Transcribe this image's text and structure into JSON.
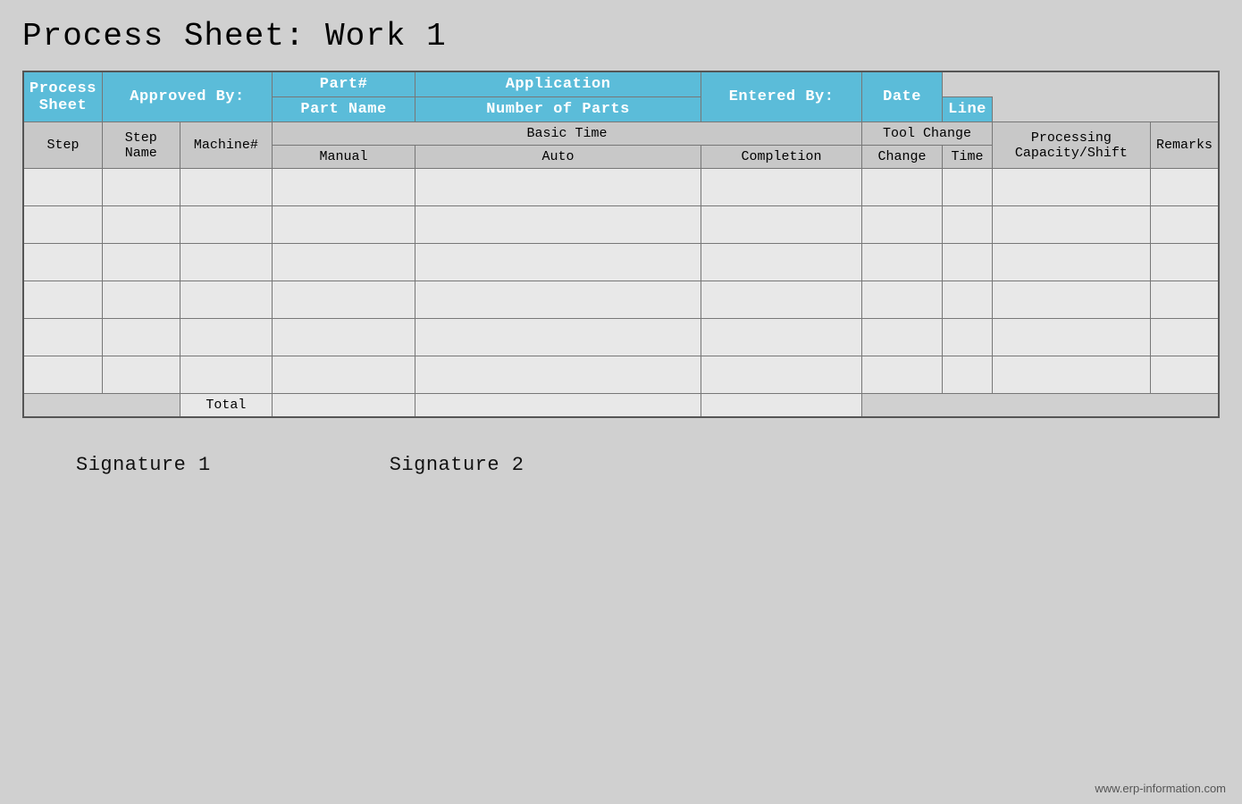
{
  "title": "Process Sheet: Work 1",
  "header_row1": {
    "process_sheet": "Process Sheet",
    "approved_by": "Approved By:",
    "part_hash": "Part#",
    "application": "Application",
    "entered_by": "Entered By:",
    "date": "Date"
  },
  "header_row2": {
    "part_name": "Part Name",
    "number_of_parts": "Number of Parts",
    "line": "Line"
  },
  "col_headers": {
    "step": "Step",
    "step_name": "Step  Name",
    "machine": "Machine#",
    "basic_time": "Basic Time",
    "manual": "Manual",
    "auto": "Auto",
    "completion": "Completion",
    "tool_change": "Tool Change",
    "change": "Change",
    "time": "Time",
    "processing_capacity": "Processing Capacity/Shift",
    "remarks": "Remarks"
  },
  "data_rows": [
    {
      "step": "",
      "step_name": "",
      "machine": "",
      "manual": "",
      "auto": "",
      "completion": "",
      "change": "",
      "time": "",
      "processing": "",
      "remarks": ""
    },
    {
      "step": "",
      "step_name": "",
      "machine": "",
      "manual": "",
      "auto": "",
      "completion": "",
      "change": "",
      "time": "",
      "processing": "",
      "remarks": ""
    },
    {
      "step": "",
      "step_name": "",
      "machine": "",
      "manual": "",
      "auto": "",
      "completion": "",
      "change": "",
      "time": "",
      "processing": "",
      "remarks": ""
    },
    {
      "step": "",
      "step_name": "",
      "machine": "",
      "manual": "",
      "auto": "",
      "completion": "",
      "change": "",
      "time": "",
      "processing": "",
      "remarks": ""
    },
    {
      "step": "",
      "step_name": "",
      "machine": "",
      "manual": "",
      "auto": "",
      "completion": "",
      "change": "",
      "time": "",
      "processing": "",
      "remarks": ""
    },
    {
      "step": "",
      "step_name": "",
      "machine": "",
      "manual": "",
      "auto": "",
      "completion": "",
      "change": "",
      "time": "",
      "processing": "",
      "remarks": ""
    }
  ],
  "total_label": "Total",
  "signatures": {
    "sig1": "Signature 1",
    "sig2": "Signature 2"
  },
  "watermark": "www.erp-information.com"
}
